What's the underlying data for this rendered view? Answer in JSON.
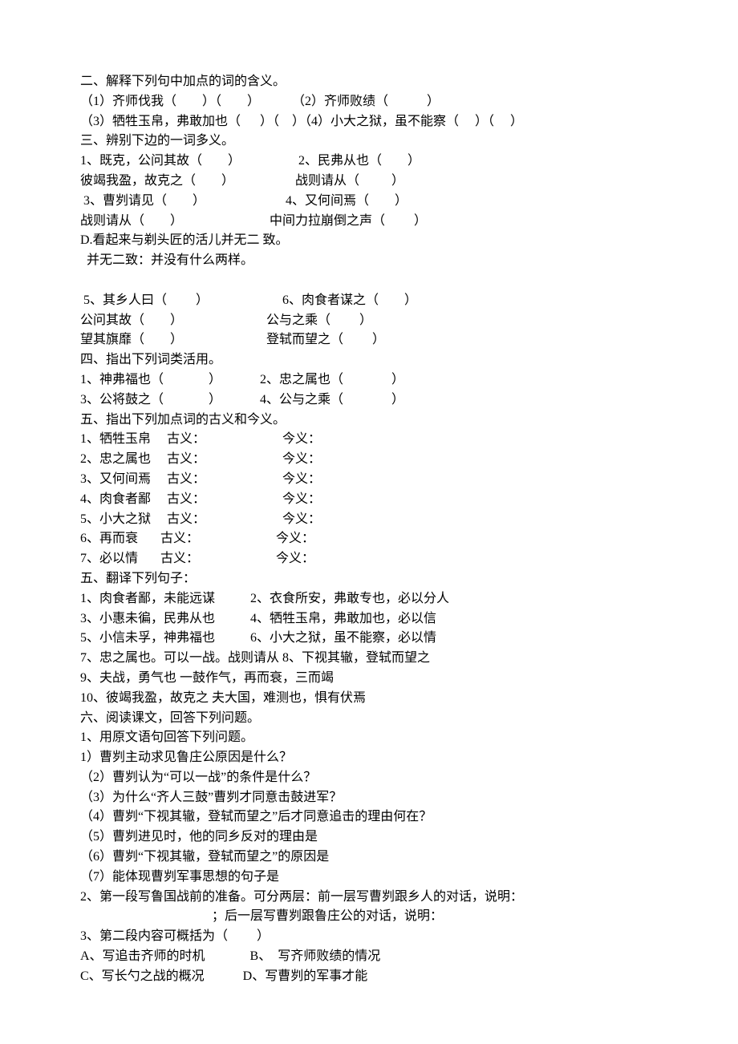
{
  "s2": {
    "title": "二、解释下列句中加点的词的含义。",
    "l1": "（1）齐师伐我（        ）（        ）          （2）齐师败绩（            ）",
    "l2": "（3）牺牲玉帛，弗敢加也（      ）（    ）（4）小大之狱，虽不能察（     ）（     ）"
  },
  "s3": {
    "title": "三、辨别下边的一词多义。",
    "r1a": "1、既克，公问其故（        ）                  2、民弗从也（        ）",
    "r1b": "彼竭我盈，故克之（        ）                   战则请从（          ）",
    "r2a": " 3、曹刿请见（        ）                         4、又何间焉（        ）",
    "r2b": "战则请从（        ）                           中间力拉崩倒之声（         ）",
    "d1": "D.看起来与剃头匠的活儿并无二 致。",
    "d2": "  并无二致：并没有什么两样。",
    "r3a": " 5、其乡人曰（         ）                       6、肉食者谋之（        ）",
    "r3b": "公问其故（        ）                          公与之乘（         ）",
    "r3c": "望其旗靡（        ）                          登轼而望之（         ）"
  },
  "s4": {
    "title": "四、指出下列词类活用。",
    "l1": "1、神弗福也（              ）            2、忠之属也（               ）",
    "l2": "3、公将鼓之（              ）            4、公与之乘（               ）"
  },
  "s5": {
    "title": "五、指出下列加点词的古义和今义。",
    "rows": [
      "1、牺牲玉帛     古义：                        今义：",
      "2、忠之属也     古义：                        今义：",
      "3、又何间焉     古义：                        今义：",
      "4、肉食者鄙     古义：                        今义：",
      "5、小大之狱     古义：                        今义：",
      "6、再而衰       古义：                        今义：",
      "7、必以情       古义：                        今义："
    ]
  },
  "s5b": {
    "title": "五、翻译下列句子：",
    "rows": [
      "1、肉食者鄙，未能远谋           2、衣食所安，弗敢专也，必以分人",
      "3、小惠未徧，民弗从也           4、牺牲玉帛，弗敢加也，必以信",
      "5、小信未孚，神弗福也           6、小大之狱，虽不能察，必以情",
      "7、忠之属也。可以一战。战则请从 8、下视其辙，登轼而望之",
      "9、夫战，勇气也 一鼓作气，再而衰，三而竭",
      "10、彼竭我盈，故克之 夫大国，难测也，惧有伏焉"
    ]
  },
  "s6": {
    "title": "六、阅读课文，回答下列问题。",
    "q1": "1、用原文语句回答下列问题。",
    "subs": [
      "1）曹刿主动求见鲁庄公原因是什么？",
      "（2）曹刿认为“可以一战”的条件是什么？",
      "（3）为什么“齐人三鼓”曹刿才同意击鼓进军？",
      "（4）曹刿“下视其辙，登轼而望之”后才同意追击的理由何在？",
      "（5）曹刿进见时，他的同乡反对的理由是",
      "（6）曹刿“下视其辙，登轼而望之”的原因是",
      "（7）能体现曹刿军事思想的句子是"
    ],
    "q2a": "2、第一段写鲁国战前的准备。可分两层：前一层写曹刿跟乡人的对话，说明：",
    "q2b": "                                         ；后一层写曹刿跟鲁庄公的对话，说明：",
    "q3": "3、第二段内容可概括为（         ）",
    "optA": "A、写追击齐师的时机              B、  写齐师败绩的情况",
    "optC": "C、写长勺之战的概况            D、写曹刿的军事才能"
  }
}
